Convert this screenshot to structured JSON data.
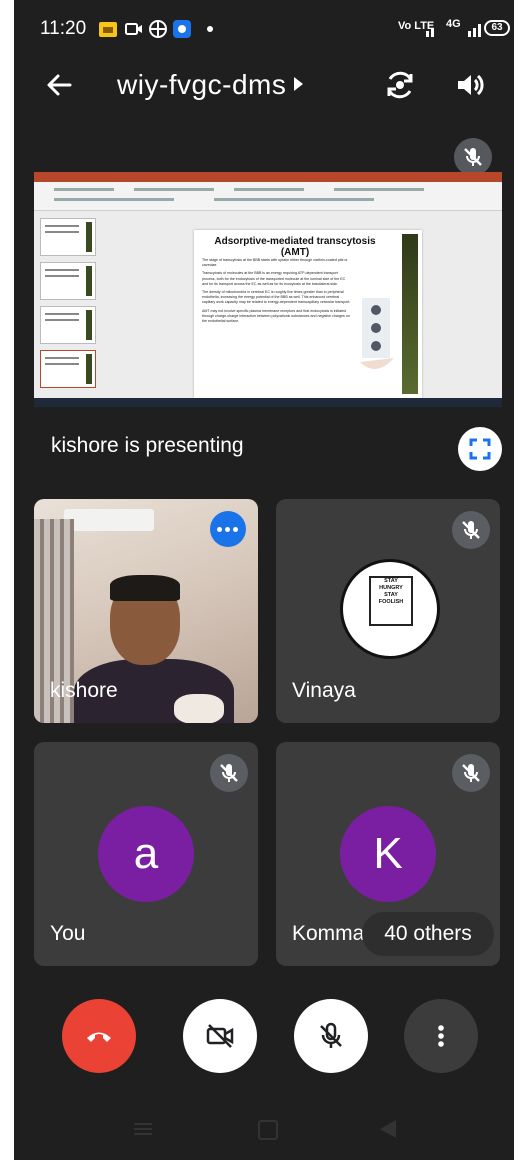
{
  "status_bar": {
    "time": "11:20",
    "network_text": "Vo LTE",
    "signal_text": "4G",
    "battery": "63"
  },
  "app_bar": {
    "meeting_code": "wiy-fvgc-dms"
  },
  "presentation": {
    "label": "kishore is presenting",
    "slide_title": "Adsorptive-mediated transcytosis (AMT)",
    "slide_bullets": [
      "The stage of transcytosis at the BBB starts with uptake either through clathrin-coated pits or caveolae.",
      "Transcytosis of molecules at the BBB is an energy requiring ATP-dependent transport process, both for the endocytosis of the transported molecule at the luminal side of the EC and for its transport across the EC as well as for its exocytosis at the basolateral side.",
      "The density of mitochondria in cerebral EC is roughly five times greater than in peripheral endothelia, increasing the energy potential of the BBB as well. This enhanced cerebral capillary work capacity may be related to energy-dependent transcapillary vesicular transport.",
      "AMT may not involve specific plasma membrane receptors and that endocytosis is initiated through charge-charge interaction between polycationic substances and negative charges on the endothelial surface."
    ]
  },
  "participants": [
    {
      "name": "kishore",
      "video": true
    },
    {
      "name": "Vinaya",
      "muted": true,
      "poster_lines": [
        "STAY",
        "HUNGRY",
        "STAY",
        "FOOLISH"
      ]
    },
    {
      "name": "You",
      "initial": "a",
      "muted": true
    },
    {
      "name": "Kommad",
      "initial": "K",
      "muted": true
    }
  ],
  "others_chip": "40 others",
  "colors": {
    "background": "#1f1f1f",
    "tile": "#3c3c3c",
    "end_call": "#ea4335",
    "avatar_purple": "#7b1fa2",
    "accent_blue": "#1a73e8"
  },
  "icons": {
    "back": "arrow-left-icon",
    "switch_camera": "switch-camera-icon",
    "speaker": "speaker-icon",
    "mic_off": "mic-off-icon",
    "fullscreen": "fullscreen-icon",
    "end_call": "phone-hangup-icon",
    "camera_off": "camera-off-icon",
    "more": "more-vert-icon"
  }
}
